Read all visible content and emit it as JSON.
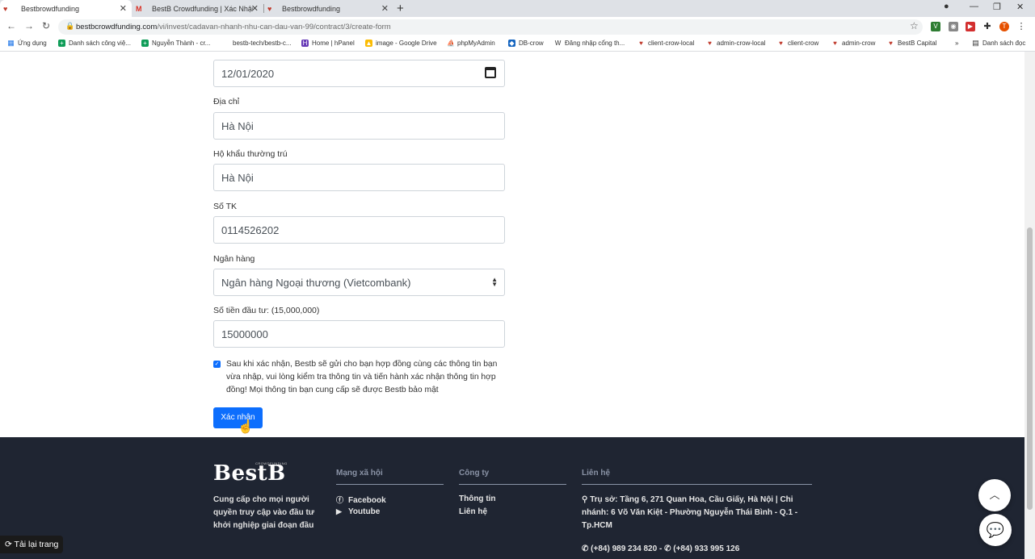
{
  "tabs": [
    {
      "title": "Bestbrowdfunding",
      "favicon": "bestb-favicon"
    },
    {
      "title": "BestB Crowdfunding | Xác Nhận …",
      "favicon": "gmail-favicon"
    },
    {
      "title": "Bestbrowdfunding",
      "favicon": "bestb-favicon"
    }
  ],
  "address_bar": {
    "domain": "bestbcrowdfunding.com",
    "path": "/vi/invest/cadavan-nhanh-nhu-can-dau-van-99/contract/3/create-form"
  },
  "bookmarks": [
    {
      "label": "Ứng dụng",
      "icon": "apps-icon"
    },
    {
      "label": "Danh sách công việ...",
      "icon": "sheets-icon"
    },
    {
      "label": "Nguyễn Thành - cr...",
      "icon": "sheets-icon"
    },
    {
      "label": "bestb-tech/bestb-c...",
      "icon": "github-icon"
    },
    {
      "label": "Home | hPanel",
      "icon": "hpanel-icon"
    },
    {
      "label": "image - Google Drive",
      "icon": "drive-icon"
    },
    {
      "label": "phpMyAdmin",
      "icon": "phpmyadmin-icon"
    },
    {
      "label": "DB-crow",
      "icon": "db-icon"
    },
    {
      "label": "Đăng nhập cổng th...",
      "icon": "portal-icon"
    },
    {
      "label": "client-crow-local",
      "icon": "bestb-icon"
    },
    {
      "label": "admin-crow-local",
      "icon": "bestb-icon"
    },
    {
      "label": "client-crow",
      "icon": "bestb-icon"
    },
    {
      "label": "admin-crow",
      "icon": "bestb-icon"
    },
    {
      "label": "BestB Capital",
      "icon": "bestb-icon"
    },
    {
      "label": "Danh sách đọc",
      "icon": "reading-list-icon"
    }
  ],
  "form": {
    "date_value": "12/01/2020",
    "address_label": "Địa chỉ",
    "address_value": "Hà Nội",
    "residence_label": "Hộ khẩu thường trú",
    "residence_value": "Hà Nội",
    "account_label": "Số TK",
    "account_value": "0114526202",
    "bank_label": "Ngân hàng",
    "bank_value": "Ngân hàng Ngoại thương (Vietcombank)",
    "amount_label": "Số tiền đầu tư: (15,000,000)",
    "amount_value": "15000000",
    "consent_checked": true,
    "consent_text": "Sau khi xác nhận, Bestb sẽ gửi cho bạn hợp đồng cùng các thông tin bạn vừa nhập, vui lòng kiểm tra thông tin và tiến hành xác nhận thông tin hợp đồng! Mọi thông tin bạn cung cấp sẽ được Bestb bảo mật",
    "submit_label": "Xác nhận"
  },
  "footer": {
    "logo": "BestB",
    "logo_sub": "CROWDFUNDING",
    "tagline": "Cung cấp cho mọi người quyền truy cập vào đầu tư khởi nghiệp giai đoạn đầu",
    "social_title": "Mạng xã hội",
    "social_links": [
      {
        "label": "Facebook",
        "icon": "facebook-icon"
      },
      {
        "label": "Youtube",
        "icon": "youtube-icon"
      }
    ],
    "company_title": "Công ty",
    "company_links": [
      "Thông tin",
      "Liên hệ"
    ],
    "contact_title": "Liên hệ",
    "contact_address": "Trụ sở: Tầng 6, 271 Quan Hoa, Cầu Giấy, Hà Nội | Chi nhánh: 6 Võ Văn Kiệt - Phường Nguyễn Thái Bình - Q.1 - Tp.HCM",
    "phone1": "(+84) 989 234 820",
    "phone_sep": " - ",
    "phone2": "(+84) 933 995 126"
  },
  "reload_label": "Tải lại trang"
}
